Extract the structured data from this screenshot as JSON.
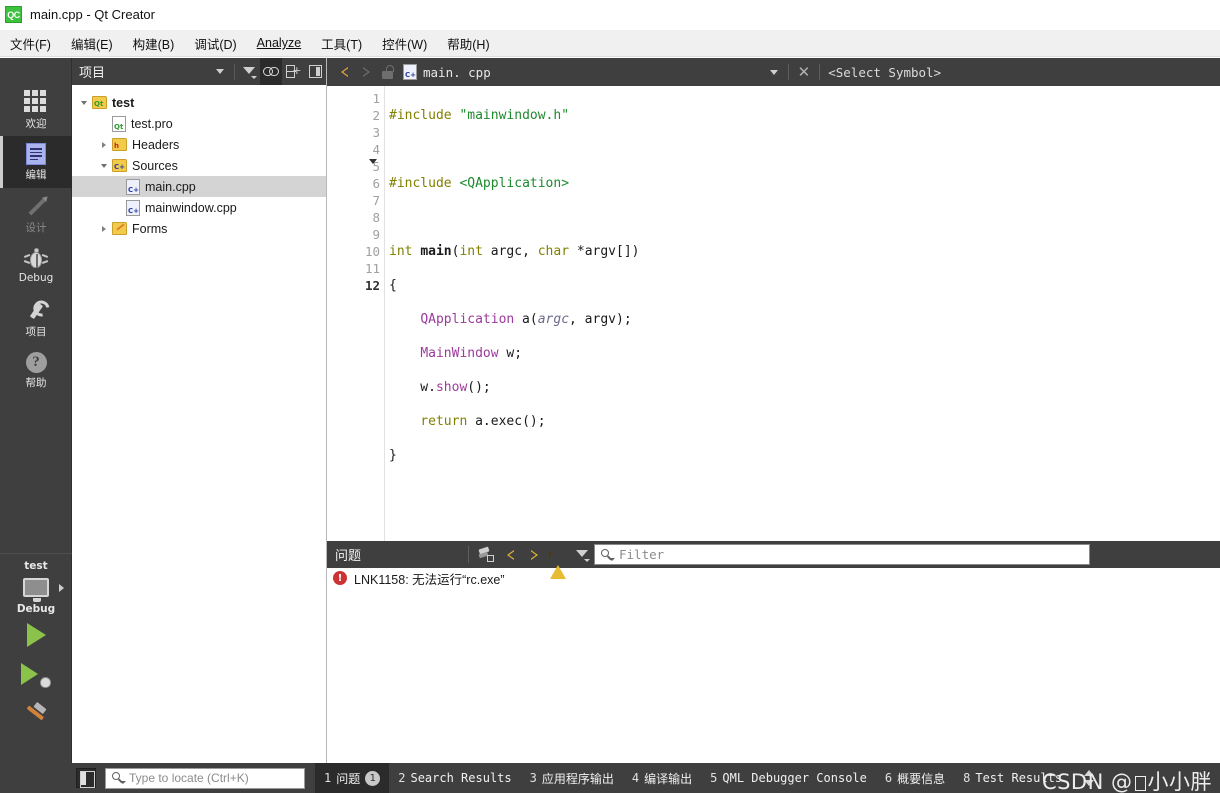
{
  "window": {
    "app_icon": "qt-creator-icon",
    "icon_text": "QC",
    "title": "main.cpp - Qt Creator"
  },
  "menubar": {
    "items": [
      {
        "label": "文件(F)",
        "accel": "F"
      },
      {
        "label": "编辑(E)",
        "accel": "E"
      },
      {
        "label": "构建(B)",
        "accel": "B"
      },
      {
        "label": "调试(D)",
        "accel": "D"
      },
      {
        "label": "Analyze",
        "accel": "A"
      },
      {
        "label": "工具(T)",
        "accel": "T"
      },
      {
        "label": "控件(W)",
        "accel": "W"
      },
      {
        "label": "帮助(H)",
        "accel": "H"
      }
    ]
  },
  "modebar": {
    "items": [
      {
        "label": "欢迎",
        "icon": "grid-icon",
        "state": "normal"
      },
      {
        "label": "编辑",
        "icon": "document-icon",
        "state": "active"
      },
      {
        "label": "设计",
        "icon": "pencil-icon",
        "state": "disabled"
      },
      {
        "label": "Debug",
        "icon": "bug-icon",
        "state": "normal"
      },
      {
        "label": "项目",
        "icon": "wrench-icon",
        "state": "normal"
      },
      {
        "label": "帮助",
        "icon": "question-circle-icon",
        "state": "normal"
      }
    ],
    "kit": {
      "project_name": "test",
      "kit_icon": "monitor-icon",
      "expand_icon": "chevron-right-icon",
      "build_config": "Debug"
    },
    "actions": [
      {
        "name": "run-button",
        "icon": "play-icon"
      },
      {
        "name": "debug-button",
        "icon": "play-bug-icon"
      },
      {
        "name": "build-button",
        "icon": "hammer-icon"
      }
    ]
  },
  "project_panel": {
    "title": "项目",
    "toolbar": [
      {
        "name": "view-selector-dropdown",
        "icon": "chevron-down-icon",
        "active": false
      },
      {
        "name": "filter-button",
        "icon": "funnel-icon",
        "active": false
      },
      {
        "name": "sync-with-editor-button",
        "icon": "link-icon",
        "active": true
      },
      {
        "name": "split-add-button",
        "icon": "split-add-icon",
        "active": false
      },
      {
        "name": "close-sidebar-button",
        "icon": "close-pane-icon",
        "active": false
      }
    ],
    "tree": [
      {
        "label": "test",
        "icon": "folder-qt-icon",
        "arrow": "down",
        "indent": 0,
        "bold": true,
        "selected": false
      },
      {
        "label": "test.pro",
        "icon": "file-qt-icon",
        "arrow": "none",
        "indent": 1,
        "bold": false,
        "selected": false
      },
      {
        "label": "Headers",
        "icon": "folder-h-icon",
        "arrow": "right",
        "indent": 1,
        "bold": false,
        "selected": false
      },
      {
        "label": "Sources",
        "icon": "folder-cpp-icon",
        "arrow": "down",
        "indent": 1,
        "bold": false,
        "selected": false
      },
      {
        "label": "main.cpp",
        "icon": "file-cpp-icon",
        "arrow": "none",
        "indent": 2,
        "bold": false,
        "selected": true
      },
      {
        "label": "mainwindow.cpp",
        "icon": "file-cpp-icon",
        "arrow": "none",
        "indent": 2,
        "bold": false,
        "selected": false
      },
      {
        "label": "Forms",
        "icon": "folder-forms-icon",
        "arrow": "right",
        "indent": 1,
        "bold": false,
        "selected": false
      }
    ]
  },
  "editor": {
    "toolbar": {
      "back_icon": "chevron-left-icon",
      "forward_icon": "chevron-right-icon",
      "lock_icon": "unlock-icon",
      "file_icon": "file-cpp-icon",
      "filename": "main. cpp",
      "dropdown_icon": "chevron-down-icon",
      "close_icon": "close-icon",
      "symbol_selector": "<Select Symbol>"
    },
    "current_line": 12,
    "fold_marker_line": 5,
    "line_count": 12,
    "lines": [
      {
        "n": 1,
        "tokens": [
          {
            "t": "#include ",
            "c": "pp"
          },
          {
            "t": "\"mainwindow.h\"",
            "c": "st"
          }
        ]
      },
      {
        "n": 2,
        "tokens": []
      },
      {
        "n": 3,
        "tokens": [
          {
            "t": "#include ",
            "c": "pp"
          },
          {
            "t": "<QApplication>",
            "c": "hdr"
          }
        ]
      },
      {
        "n": 4,
        "tokens": []
      },
      {
        "n": 5,
        "tokens": [
          {
            "t": "int ",
            "c": "k"
          },
          {
            "t": "main",
            "c": "kb"
          },
          {
            "t": "(",
            "c": "pl2"
          },
          {
            "t": "int",
            "c": "k"
          },
          {
            "t": " argc, ",
            "c": "pl2"
          },
          {
            "t": "char",
            "c": "k"
          },
          {
            "t": " *argv[])",
            "c": "pl2"
          }
        ]
      },
      {
        "n": 6,
        "tokens": [
          {
            "t": "{",
            "c": "pl2"
          }
        ]
      },
      {
        "n": 7,
        "tokens": [
          {
            "t": "    ",
            "c": "pl2"
          },
          {
            "t": "QApplication",
            "c": "ty"
          },
          {
            "t": " a(",
            "c": "pl2"
          },
          {
            "t": "argc",
            "c": "pm"
          },
          {
            "t": ", argv);",
            "c": "pl2"
          }
        ]
      },
      {
        "n": 8,
        "tokens": [
          {
            "t": "    ",
            "c": "pl2"
          },
          {
            "t": "MainWindow",
            "c": "ty"
          },
          {
            "t": " w;",
            "c": "pl2"
          }
        ]
      },
      {
        "n": 9,
        "tokens": [
          {
            "t": "    w.",
            "c": "pl2"
          },
          {
            "t": "show",
            "c": "ty"
          },
          {
            "t": "();",
            "c": "pl2"
          }
        ]
      },
      {
        "n": 10,
        "tokens": [
          {
            "t": "    ",
            "c": "pl2"
          },
          {
            "t": "return",
            "c": "k"
          },
          {
            "t": " a.exec();",
            "c": "pl2"
          }
        ]
      },
      {
        "n": 11,
        "tokens": [
          {
            "t": "}",
            "c": "pl2"
          }
        ]
      },
      {
        "n": 12,
        "tokens": []
      }
    ]
  },
  "issues_pane": {
    "title": "问题",
    "toolbar": [
      {
        "name": "clear-button",
        "icon": "clear-pane-icon"
      },
      {
        "name": "previous-issue-button",
        "icon": "chevron-left-icon"
      },
      {
        "name": "next-issue-button",
        "icon": "chevron-right-icon"
      },
      {
        "name": "filter-warnings-button",
        "icon": "warning-triangle-icon"
      },
      {
        "name": "filter-button",
        "icon": "funnel-icon"
      }
    ],
    "filter": {
      "placeholder": "Filter",
      "value": "",
      "icon": "magnifier-icon"
    },
    "rows": [
      {
        "severity": "error",
        "icon": "error-circle-icon",
        "text": "LNK1158: 无法运行“rc.exe”"
      }
    ]
  },
  "statusbar": {
    "sidebar_toggle_icon": "sidebar-toggle-icon",
    "locator": {
      "placeholder": "Type to locate (Ctrl+K)",
      "value": "",
      "icon": "magnifier-icon"
    },
    "tabs": [
      {
        "num": "1",
        "label": "问题",
        "badge": "1",
        "active": true
      },
      {
        "num": "2",
        "label": "Search Results",
        "badge": null,
        "active": false
      },
      {
        "num": "3",
        "label": "应用程序输出",
        "badge": null,
        "active": false
      },
      {
        "num": "4",
        "label": "编译输出",
        "badge": null,
        "active": false
      },
      {
        "num": "5",
        "label": "QML Debugger Console",
        "badge": null,
        "active": false
      },
      {
        "num": "6",
        "label": "概要信息",
        "badge": null,
        "active": false
      },
      {
        "num": "8",
        "label": "Test Results",
        "badge": null,
        "active": false
      }
    ],
    "resize_icon": "up-down-arrows-icon",
    "watermark_prefix": "CSDN @",
    "watermark_suffix": "小小胖"
  },
  "colors": {
    "chrome_dark": "#3f3f3f",
    "chrome_active": "#2b2b2b",
    "accent_green": "#8ac24a",
    "error_red": "#cc3333",
    "warn_yellow": "#e8bc32",
    "selection_grey": "#d4d4d4",
    "string_green": "#1d8a2e",
    "keyword_olive": "#808000",
    "type_purple": "#9b3b9b"
  }
}
